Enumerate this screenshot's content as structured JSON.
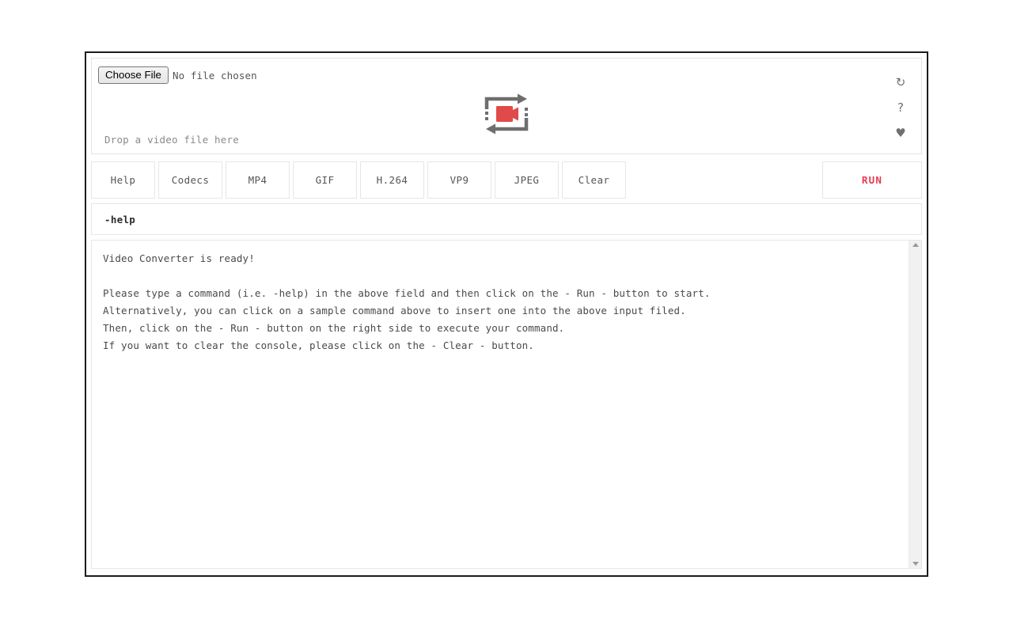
{
  "file_picker": {
    "choose_label": "Choose File",
    "status": "No file chosen"
  },
  "drop_zone": {
    "hint": "Drop a video file here",
    "icon": "video-convert-icon",
    "icon_color": "#e04a4a"
  },
  "panel_tools": [
    {
      "name": "refresh-icon",
      "glyph": "↻"
    },
    {
      "name": "help-icon",
      "glyph": "?"
    },
    {
      "name": "favorite-icon",
      "glyph": "♥"
    }
  ],
  "commands": [
    {
      "label": "Help"
    },
    {
      "label": "Codecs"
    },
    {
      "label": "MP4"
    },
    {
      "label": "GIF"
    },
    {
      "label": "H.264"
    },
    {
      "label": "VP9"
    },
    {
      "label": "JPEG"
    },
    {
      "label": "Clear"
    }
  ],
  "run": {
    "label": "RUN",
    "color": "#e8384f"
  },
  "command_input": {
    "value": "-help",
    "placeholder": "-help"
  },
  "console": {
    "text": "Video Converter is ready!\n\nPlease type a command (i.e. -help) in the above field and then click on the - Run - button to start.\nAlternatively, you can click on a sample command above to insert one into the above input filed.\nThen, click on the - Run - button on the right side to execute your command.\nIf you want to clear the console, please click on the - Clear - button."
  }
}
